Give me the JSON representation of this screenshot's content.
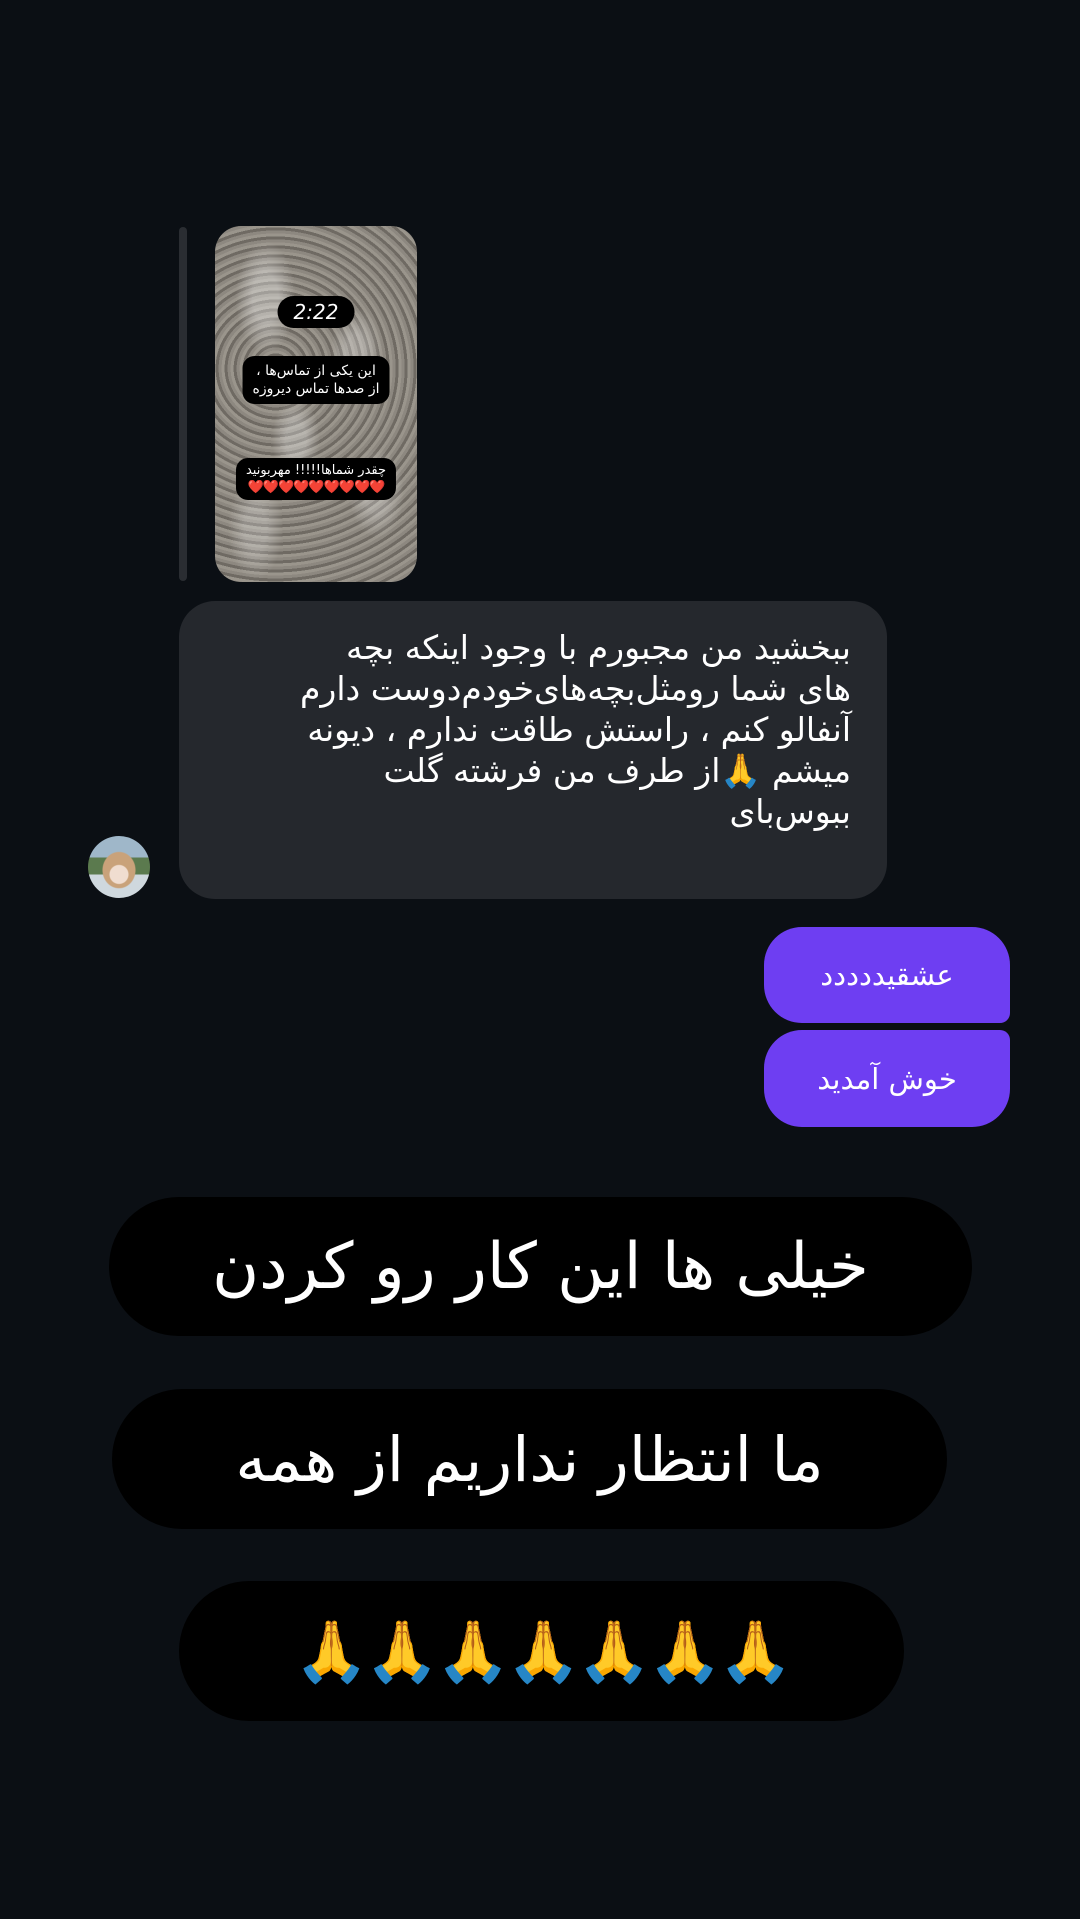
{
  "story_reply": {
    "timer": "2:22",
    "caption_line1": "این یکی از تماس‌ها ،",
    "caption_line2": "از صدها تماس دیروزه",
    "caption2_line1": "چقدر شماها!!!!! مهربونید",
    "caption2_hearts": "❤️❤️❤️❤️❤️❤️❤️❤️❤️"
  },
  "incoming_message": {
    "text": "ببخشید من مجبورم با وجود اینکه بچه\nهای شما رومثل‌بچه‌های‌خودم‌دوست دارم\nآنفالو کنم ، راستش طاقت ندارم ، دیونه\nمیشم 🙏از طرف من فرشته گلت\nببوس‌بای"
  },
  "outgoing_messages": [
    {
      "text": "عشقیددددد"
    },
    {
      "text": "خوش آمدید"
    }
  ],
  "overlay_banners": [
    {
      "text": "خیلی ها  این کار رو کردن"
    },
    {
      "text": "ما  انتظار  نداریم از همه"
    },
    {
      "text": "🙏🙏🙏🙏🙏🙏🙏"
    }
  ],
  "colors": {
    "background": "#0b0f14",
    "incoming_bubble": "#25282d",
    "outgoing_bubble": "#6e3ef2",
    "banner": "#000000"
  }
}
